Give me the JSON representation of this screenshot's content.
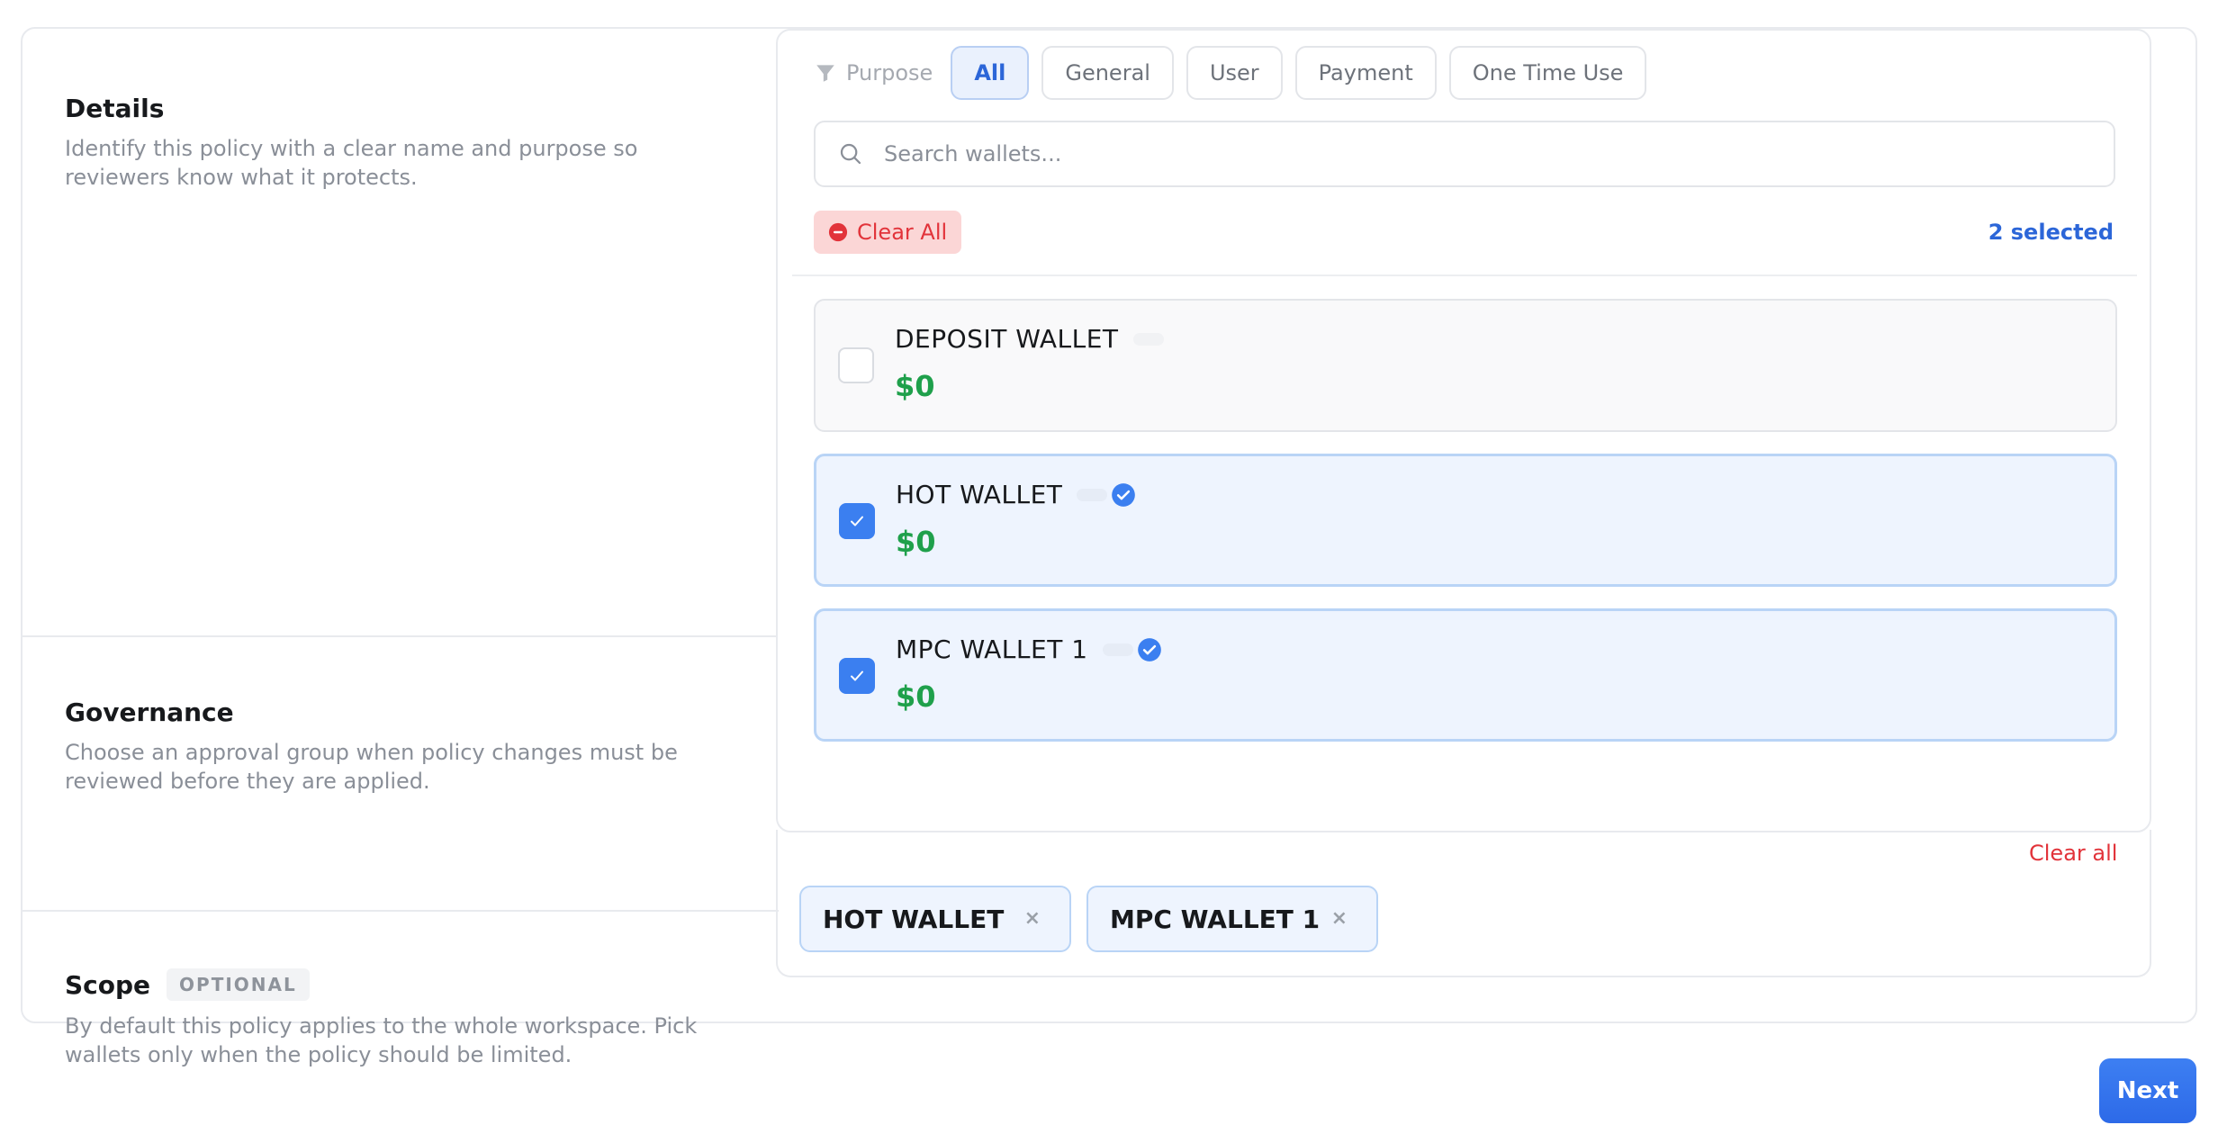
{
  "sections": {
    "details": {
      "title": "Details",
      "description": "Identify this policy with a clear name and purpose so reviewers know what it protects."
    },
    "governance": {
      "title": "Governance",
      "description": "Choose an approval group when policy changes must be reviewed before they are applied."
    },
    "scope": {
      "title": "Scope",
      "badge": "OPTIONAL",
      "description": "By default this policy applies to the whole workspace. Pick wallets only when the policy should be limited."
    }
  },
  "picker": {
    "purpose_label": "Purpose",
    "filters": [
      "All",
      "General",
      "User",
      "Payment",
      "One Time Use"
    ],
    "active_filter": "All",
    "search_placeholder": "Search wallets...",
    "clear_all_button": "Clear All",
    "selected_count": "2 selected",
    "wallets": [
      {
        "name": "DEPOSIT WALLET",
        "balance": "$0",
        "checked": false,
        "verified": false
      },
      {
        "name": "HOT WALLET",
        "balance": "$0",
        "checked": true,
        "verified": true
      },
      {
        "name": "MPC WALLET 1",
        "balance": "$0",
        "checked": true,
        "verified": true
      }
    ]
  },
  "selected_tags": {
    "clear_all_link": "Clear all",
    "tags": [
      "HOT WALLET",
      "MPC WALLET 1"
    ],
    "remove_glyph": "×"
  },
  "footer": {
    "next_label": "Next"
  },
  "colors": {
    "accent": "#3b7ff0",
    "danger": "#e2333a",
    "balance_green": "#1fa04b",
    "selected_bg": "#eef4fe"
  }
}
